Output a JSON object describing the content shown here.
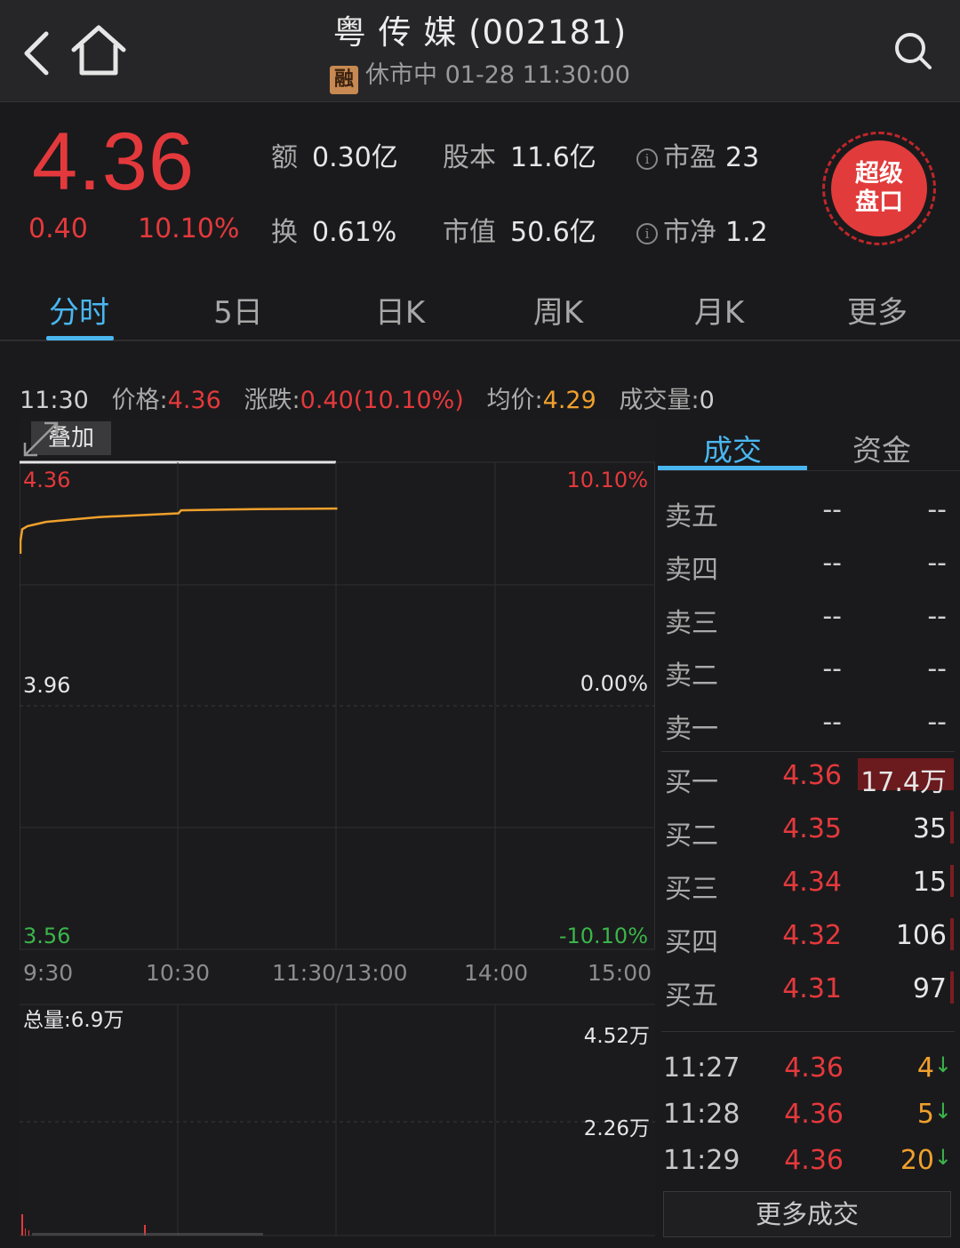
{
  "header": {
    "title": "粤 传 媒 (002181)",
    "badge": "融",
    "status": "休市中 01-28 11:30:00"
  },
  "quote": {
    "price": "4.36",
    "change": "0.40",
    "change_pct": "10.10%",
    "amount_label": "额",
    "amount": "0.30亿",
    "turnover_label": "换",
    "turnover": "0.61%",
    "shares_label": "股本",
    "shares": "11.6亿",
    "mktcap_label": "市值",
    "mktcap": "50.6亿",
    "pe_label": "市盈",
    "pe": "23",
    "pb_label": "市净",
    "pb": "1.2",
    "info_icon": "i",
    "super_button": [
      "超级",
      "盘口"
    ]
  },
  "tabs": [
    "分时",
    "5日",
    "日K",
    "周K",
    "月K",
    "更多"
  ],
  "info_line": {
    "time": "11:30",
    "price_label": "价格:",
    "price": "4.36",
    "change_label": "涨跌:",
    "change": "0.40(10.10%)",
    "avg_label": "均价:",
    "avg": "4.29",
    "vol_label": "成交量:",
    "vol": "0"
  },
  "chart": {
    "overlay_button": "叠加",
    "price_labels": [
      "4.36",
      "3.96",
      "3.56"
    ],
    "pct_labels": [
      "10.10%",
      "0.00%",
      "-10.10%"
    ],
    "time_labels": [
      "9:30",
      "10:30",
      "11:30/13:00",
      "14:00",
      "15:00"
    ],
    "volume_total": "总量:6.9万",
    "volume_labels": [
      "4.52万",
      "2.26万"
    ]
  },
  "chart_data": {
    "type": "line",
    "ylim": [
      3.56,
      4.36
    ],
    "x": [
      "9:30",
      "9:31",
      "9:33",
      "9:36",
      "9:40",
      "9:50",
      "10:00",
      "10:15",
      "10:30",
      "10:31",
      "11:00",
      "11:30"
    ],
    "series": [
      {
        "values": [
          4.23,
          4.25,
          4.255,
          4.258,
          4.262,
          4.266,
          4.27,
          4.273,
          4.276,
          4.281,
          4.283,
          4.284
        ]
      }
    ]
  },
  "right_panel": {
    "tabs": [
      "成交",
      "资金"
    ],
    "asks": [
      {
        "label": "卖五",
        "price": "--",
        "vol": "--"
      },
      {
        "label": "卖四",
        "price": "--",
        "vol": "--"
      },
      {
        "label": "卖三",
        "price": "--",
        "vol": "--"
      },
      {
        "label": "卖二",
        "price": "--",
        "vol": "--"
      },
      {
        "label": "卖一",
        "price": "--",
        "vol": "--"
      }
    ],
    "bids": [
      {
        "label": "买一",
        "price": "4.36",
        "vol": "17.4万"
      },
      {
        "label": "买二",
        "price": "4.35",
        "vol": "35"
      },
      {
        "label": "买三",
        "price": "4.34",
        "vol": "15"
      },
      {
        "label": "买四",
        "price": "4.32",
        "vol": "106"
      },
      {
        "label": "买五",
        "price": "4.31",
        "vol": "97"
      }
    ],
    "trades": [
      {
        "time": "11:27",
        "price": "4.36",
        "vol": "4",
        "dir": "↓"
      },
      {
        "time": "11:28",
        "price": "4.36",
        "vol": "5",
        "dir": "↓"
      },
      {
        "time": "11:29",
        "price": "4.36",
        "vol": "20",
        "dir": "↓"
      }
    ],
    "more_button": "更多成交"
  },
  "colors": {
    "up": "#e4393c",
    "accent": "#4ab6f0",
    "avg": "#f0a02c",
    "down": "#3bb54a"
  }
}
